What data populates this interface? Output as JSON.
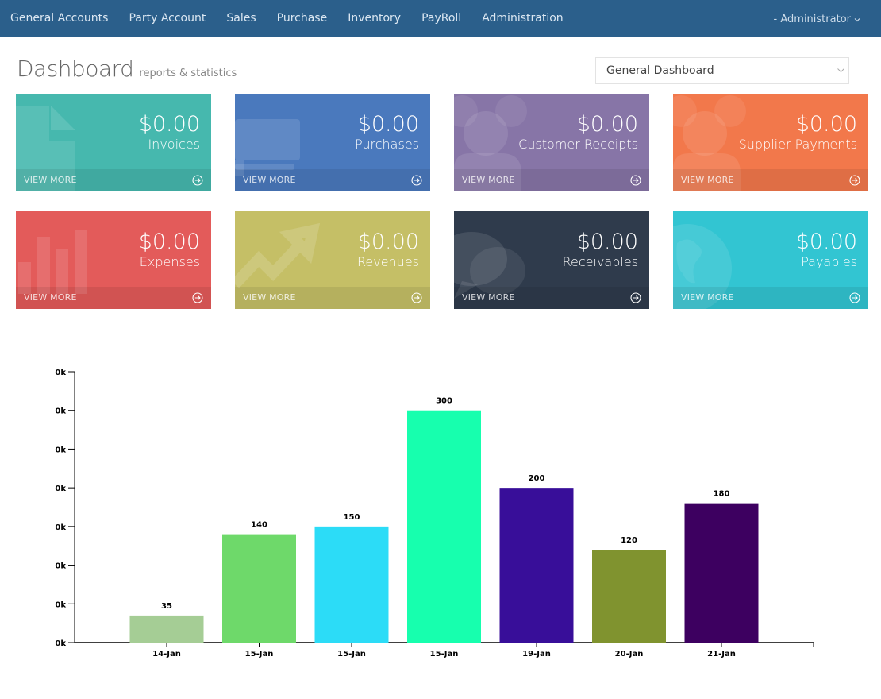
{
  "nav": {
    "items": [
      "General Accounts",
      "Party Account",
      "Sales",
      "Purchase",
      "Inventory",
      "PayRoll",
      "Administration"
    ],
    "user_label": "- Administrator"
  },
  "header": {
    "title": "Dashboard",
    "subtitle": "reports & statistics",
    "dashboard_select": "General Dashboard"
  },
  "tiles": [
    {
      "amount": "$0.00",
      "label": "Invoices",
      "more": "VIEW MORE",
      "icon": "document-icon",
      "color": "#46b8ae"
    },
    {
      "amount": "$0.00",
      "label": "Purchases",
      "more": "VIEW MORE",
      "icon": "cart-icon",
      "color": "#4a79bd"
    },
    {
      "amount": "$0.00",
      "label": "Customer Receipts",
      "more": "VIEW MORE",
      "icon": "users-icon",
      "color": "#8775a7"
    },
    {
      "amount": "$0.00",
      "label": "Supplier Payments",
      "more": "VIEW MORE",
      "icon": "users-icon",
      "color": "#f2784b"
    },
    {
      "amount": "$0.00",
      "label": "Expenses",
      "more": "VIEW MORE",
      "icon": "bar-chart-icon",
      "color": "#e35b5a"
    },
    {
      "amount": "$0.00",
      "label": "Revenues",
      "more": "VIEW MORE",
      "icon": "trend-up-icon",
      "color": "#c5bf66"
    },
    {
      "amount": "$0.00",
      "label": "Receivables",
      "more": "VIEW MORE",
      "icon": "comments-icon",
      "color": "#2f3b4c"
    },
    {
      "amount": "$0.00",
      "label": "Payables",
      "more": "VIEW MORE",
      "icon": "globe-icon",
      "color": "#32c5d2"
    }
  ],
  "chart_data": {
    "type": "bar",
    "title": "",
    "xlabel": "",
    "ylabel": "",
    "categories": [
      "14-Jan",
      "15-Jan",
      "15-Jan",
      "15-Jan",
      "19-Jan",
      "20-Jan",
      "21-Jan"
    ],
    "values": [
      35,
      140,
      150,
      300,
      200,
      120,
      180
    ],
    "colors": [
      "#a5cd95",
      "#6ed96a",
      "#2cdcf7",
      "#17ffae",
      "#380e99",
      "#80932f",
      "#3d0060"
    ],
    "y_tick_labels": [
      "0k",
      "0k",
      "0k",
      "0k",
      "0k",
      "0k",
      "0k",
      "0k"
    ],
    "ylim": [
      0,
      350
    ],
    "grid": false,
    "legend": "none"
  }
}
